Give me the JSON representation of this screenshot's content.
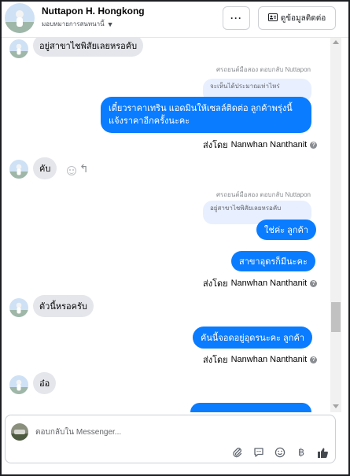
{
  "header": {
    "name": "Nuttapon H. Hongkong",
    "assign_label": "มอบหมายการสนทนานี้",
    "more_label": "···",
    "contact_label": "ดูข้อมูลติดต่อ"
  },
  "messages": {
    "m1": "อยู่สาขาไชพิสัยเลยหรอคับ",
    "reply1_note": "ศรถยนต์มือสอง ตอบกลับ Nuttapon",
    "quote1": "จะเห็นได้ประมาณเท่าไหร่",
    "out1": "เดี๋ยวราคาเทริน แอดมินให้เซลล์ติดต่อ ลูกค้าพรุ่งนี้แจ้งราคาอีกครั้งนะคะ",
    "sent1_label": "ส่งโดย",
    "sent1_name": "Nanwhan Nanthanit",
    "m2": "คับ",
    "reply2_note": "ศรถยนต์มือสอง ตอบกลับ Nuttapon",
    "quote2": "อยู่สาขาไชพิสัยเลยหรอคับ",
    "out2": "ใช่ค่ะ ลูกค้า",
    "out3": "สาขาอุดรก็มีนะคะ",
    "sent2_label": "ส่งโดย",
    "sent2_name": "Nanwhan Nanthanit",
    "m3": "ตัวนี้หรอครับ",
    "out4": "คันนี้จอดอยู่อุดรนะคะ ลูกค้า",
    "sent3_label": "ส่งโดย",
    "sent3_name": "Nanwhan Nanthanit",
    "m4": "อ๋อ"
  },
  "composer": {
    "placeholder": "ตอบกลับใน Messenger..."
  },
  "icons": {
    "attach": "paperclip-icon",
    "saved_replies": "chat-bubble-icon",
    "emoji": "smiley-icon",
    "payment": "baht-icon",
    "like": "thumbs-up-icon"
  },
  "colors": {
    "outgoing": "#0a7cff",
    "incoming": "#e4e6eb",
    "quote": "#e8efff"
  }
}
